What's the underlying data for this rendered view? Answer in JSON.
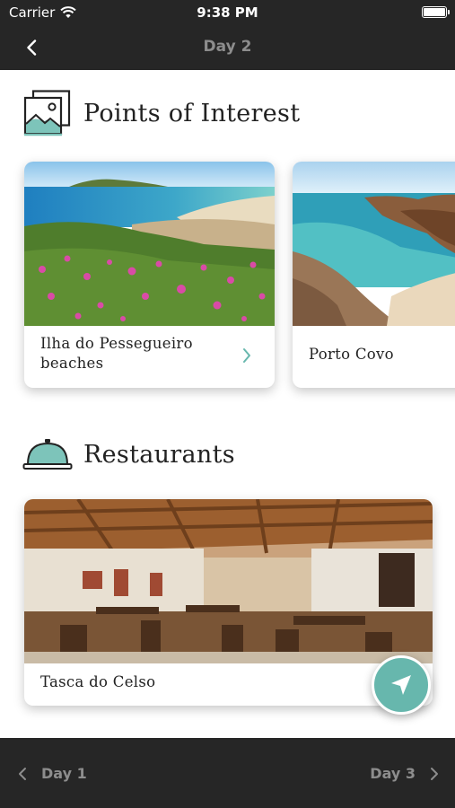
{
  "status_bar": {
    "carrier": "Carrier",
    "time": "9:38 PM",
    "icons": [
      "wifi-icon",
      "battery-icon"
    ]
  },
  "nav": {
    "title": "Day 2",
    "back_icon": "chevron-left-icon"
  },
  "points_of_interest": {
    "title": "Points of Interest",
    "icon": "photos-icon",
    "cards": [
      {
        "label_line1": "Ilha do Pessegueiro",
        "label_line2": "beaches",
        "icon": "chevron-right-icon"
      },
      {
        "label": "Porto Covo"
      }
    ]
  },
  "restaurants": {
    "title": "Restaurants",
    "icon": "service-bell-icon",
    "cards": [
      {
        "label": "Tasca do Celso"
      }
    ]
  },
  "fab": {
    "icon": "navigation-arrow-icon"
  },
  "bottom_nav": {
    "prev_label": "Day 1",
    "next_label": "Day 3"
  },
  "colors": {
    "bar_background": "#262626",
    "accent_teal": "#67b7ad",
    "muted_text": "#8d8d8d"
  }
}
